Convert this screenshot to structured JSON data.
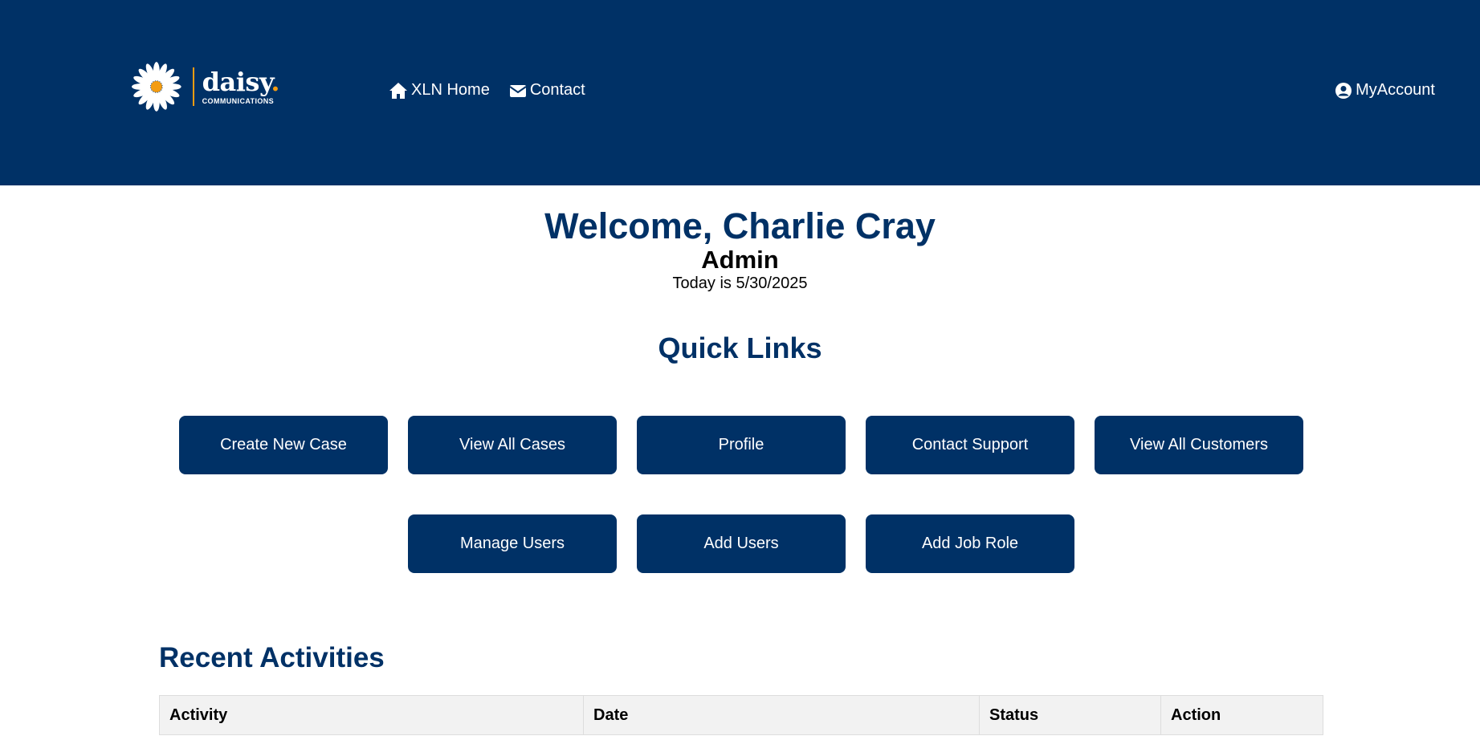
{
  "header": {
    "logo": {
      "name": "daisy",
      "dot": ".",
      "sub": "COMMUNICATIONS"
    },
    "nav": [
      {
        "label": "XLN Home",
        "icon": "home-icon"
      },
      {
        "label": "Contact",
        "icon": "envelope-icon"
      }
    ],
    "account": {
      "label": "MyAccount",
      "icon": "user-circle-icon"
    }
  },
  "welcome": {
    "greeting": "Welcome, Charlie Cray",
    "role": "Admin",
    "today": "Today is 5/30/2025"
  },
  "quick_links": {
    "title": "Quick Links",
    "buttons": [
      {
        "label": "Create New Case"
      },
      {
        "label": "View All Cases"
      },
      {
        "label": "Profile"
      },
      {
        "label": "Contact Support"
      },
      {
        "label": "View All Customers"
      },
      {
        "label": "Manage Users"
      },
      {
        "label": "Add Users"
      },
      {
        "label": "Add Job Role"
      }
    ]
  },
  "recent_activities": {
    "title": "Recent Activities",
    "columns": [
      "Activity",
      "Date",
      "Status",
      "Action"
    ]
  },
  "colors": {
    "brand": "#003166",
    "accent": "#f39c12",
    "table_header_bg": "#f2f2f2"
  }
}
